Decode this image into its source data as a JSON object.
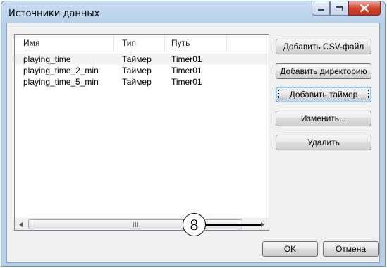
{
  "window": {
    "title": "Источники данных"
  },
  "list": {
    "columns": [
      "Имя",
      "Тип",
      "Путь"
    ],
    "rows": [
      {
        "name": "playing_time",
        "type": "Таймер",
        "path": "Timer01"
      },
      {
        "name": "playing_time_2_min",
        "type": "Таймер",
        "path": "Timer01"
      },
      {
        "name": "playing_time_5_min",
        "type": "Таймер",
        "path": "Timer01"
      }
    ]
  },
  "buttons": {
    "add_csv": "Добавить CSV-файл",
    "add_directory": "Добавить директорию",
    "add_timer": "Добавить таймер",
    "edit": "Изменить...",
    "delete": "Удалить",
    "ok": "OK",
    "cancel": "Отмена"
  },
  "callout": {
    "number": "8"
  },
  "icons": {
    "minimize": "minimize-icon",
    "maximize": "maximize-icon",
    "close": "close-icon",
    "scroll_left": "scroll-left-arrow-icon",
    "scroll_right": "scroll-right-arrow-icon",
    "grip": "scroll-grip-icon"
  },
  "colors": {
    "window_frame": "#b7d0ea",
    "close_button": "#c1301b",
    "default_button_border": "#3c7fb1"
  }
}
